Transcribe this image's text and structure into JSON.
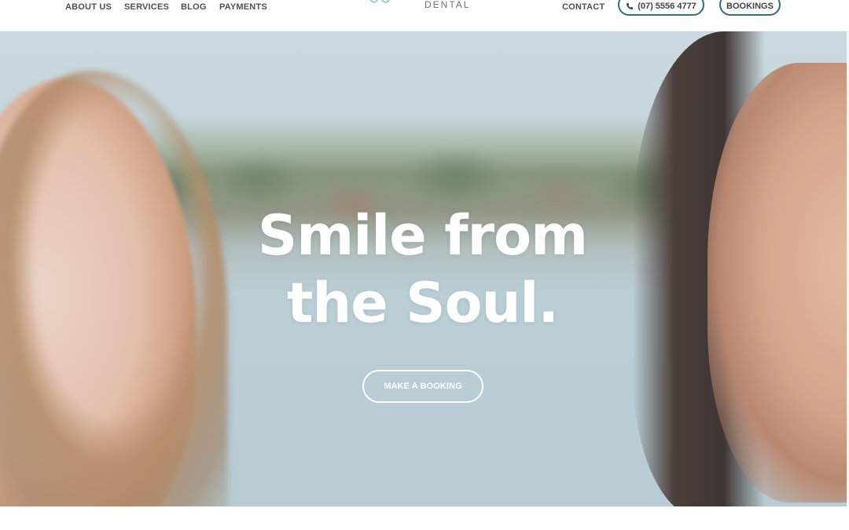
{
  "header": {
    "nav_left": [
      "ABOUT US",
      "SERVICES",
      "BLOG",
      "PAYMENTS"
    ],
    "logo_text": "DENTAL",
    "logo_icon": "tooth-icon",
    "nav_right": {
      "contact": "CONTACT",
      "phone": "(07) 5556 4777",
      "phone_icon": "phone-icon",
      "bookings": "BOOKINGS"
    }
  },
  "hero": {
    "title_line1": "Smile from",
    "title_line2": "the Soul.",
    "cta": "MAKE A BOOKING"
  },
  "colors": {
    "accent": "#2f6f7a",
    "nav_text": "#4b5257"
  }
}
